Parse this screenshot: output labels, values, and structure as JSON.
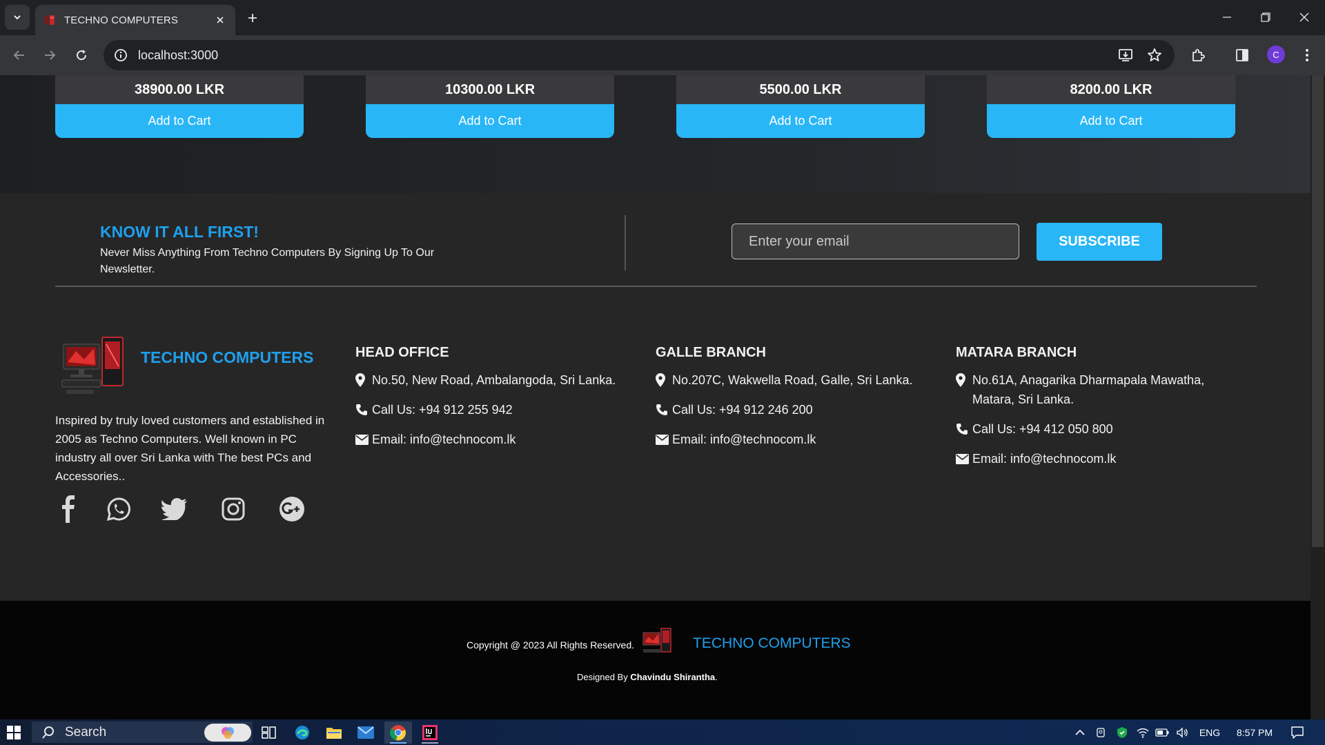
{
  "browser": {
    "tab_title": "TECHNO COMPUTERS",
    "url": "localhost:3000",
    "profile_initial": "C"
  },
  "products": [
    {
      "price": "38900.00 LKR",
      "button": "Add to Cart"
    },
    {
      "price": "10300.00 LKR",
      "button": "Add to Cart"
    },
    {
      "price": "5500.00 LKR",
      "button": "Add to Cart"
    },
    {
      "price": "8200.00 LKR",
      "button": "Add to Cart"
    }
  ],
  "newsletter": {
    "title": "KNOW IT ALL FIRST!",
    "description": "Never Miss Anything From Techno Computers By Signing Up To Our Newsletter.",
    "email_placeholder": "Enter your email",
    "subscribe_label": "SUBSCRIBE"
  },
  "footer": {
    "brand_name": "TECHNO COMPUTERS",
    "about": "Inspired by truly loved customers and established in 2005 as Techno Computers. Well known in PC industry all over Sri Lanka with The best PCs and Accessories..",
    "socials": [
      "facebook-icon",
      "whatsapp-icon",
      "twitter-icon",
      "instagram-icon",
      "google-plus-icon"
    ],
    "offices": [
      {
        "title": "HEAD OFFICE",
        "address": "No.50, New Road, Ambalangoda, Sri Lanka.",
        "phone": "Call Us: +94 912 255 942",
        "email": "Email: info@technocom.lk"
      },
      {
        "title": "GALLE BRANCH",
        "address": "No.207C, Wakwella Road, Galle, Sri Lanka.",
        "phone": "Call Us: +94 912 246 200",
        "email": "Email: info@technocom.lk"
      },
      {
        "title": "MATARA BRANCH",
        "address": "No.61A, Anagarika Dharmapala Mawatha, Matara, Sri Lanka.",
        "phone": "Call Us: +94 412 050 800",
        "email": "Email: info@technocom.lk"
      }
    ],
    "copyright": "Copyright @ 2023 All Rights Reserved.",
    "bottom_brand": "TECHNO COMPUTERS",
    "designed_prefix": "Designed By ",
    "designer": "Chavindu Shirantha",
    "designed_suffix": "."
  },
  "taskbar": {
    "search_label": "Search",
    "language": "ENG",
    "time": "8:57 PM"
  },
  "colors": {
    "accent": "#29b6f6",
    "brand_blue": "#1ea0ee",
    "page_bg": "#262626",
    "bottom_bar": "#050505"
  }
}
